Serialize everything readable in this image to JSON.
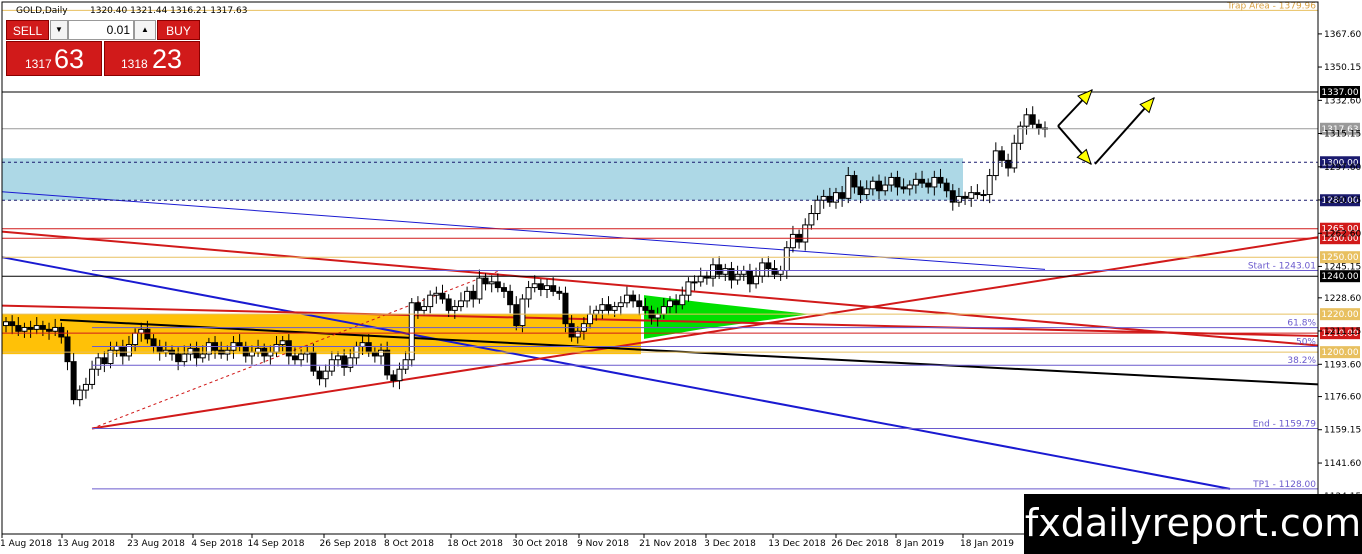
{
  "header": {
    "title": "GOLD,Daily",
    "ohlc": "1320.40 1321.44 1316.21 1317.63"
  },
  "trade_panel": {
    "sell_label": "SELL",
    "buy_label": "BUY",
    "lot_value": "0.01",
    "sell_price_small": "1317",
    "sell_price_big": "63",
    "buy_price_small": "1318",
    "buy_price_big": "23"
  },
  "watermark": "fxdailyreport.com",
  "colors": {
    "zone_blue": "#add8e6",
    "zone_orange": "#ffc107",
    "triangle_green": "#00e000",
    "trend_red": "#d11a1a",
    "trend_blue": "#1a1ad1",
    "fib_blue": "#6a5acd",
    "arrow_yellow": "#ffff00",
    "level_gold": "#e8c060"
  },
  "chart_data": {
    "type": "candlestick",
    "title": "GOLD,Daily",
    "ylim": [
      1125,
      1385
    ],
    "y_ticks": [
      1367.6,
      1350.15,
      1332.6,
      1315.15,
      1297.6,
      1280.15,
      1262.6,
      1245.15,
      1228.6,
      1211.15,
      1193.6,
      1176.6,
      1159.15,
      1141.6,
      1124.15
    ],
    "y_tick_labels": [
      "1367.60",
      "1350.15",
      "1332.60",
      "1315.15",
      "1297.60",
      "1280.15",
      "1262.60",
      "1245.15",
      "1228.60",
      "1211.15",
      "1193.60",
      "1176.60",
      "1159.15",
      "1141.60",
      "1124.15"
    ],
    "x_labels": [
      "1 Aug 2018",
      "13 Aug 2018",
      "23 Aug 2018",
      "4 Sep 2018",
      "14 Sep 2018",
      "26 Sep 2018",
      "8 Oct 2018",
      "18 Oct 2018",
      "30 Oct 2018",
      "9 Nov 2018",
      "21 Nov 2018",
      "3 Dec 2018",
      "13 Dec 2018",
      "26 Dec 2018",
      "8 Jan 2019",
      "18 Jan 2019"
    ],
    "grid": false,
    "closes": [
      1216,
      1214,
      1211,
      1213,
      1212,
      1214,
      1212,
      1211,
      1213,
      1208,
      1195,
      1175,
      1180,
      1183,
      1191,
      1197,
      1194,
      1201,
      1203,
      1198,
      1204,
      1210,
      1212,
      1207,
      1203,
      1200,
      1201,
      1199,
      1195,
      1199,
      1202,
      1197,
      1199,
      1205,
      1201,
      1199,
      1201,
      1205,
      1203,
      1198,
      1200,
      1202,
      1198,
      1200,
      1204,
      1206,
      1198,
      1196,
      1199,
      1200,
      1190,
      1186,
      1190,
      1196,
      1198,
      1192,
      1197,
      1203,
      1205,
      1200,
      1198,
      1201,
      1188,
      1185,
      1191,
      1196,
      1226,
      1222,
      1224,
      1230,
      1231,
      1228,
      1222,
      1224,
      1227,
      1232,
      1228,
      1239,
      1236,
      1237,
      1234,
      1232,
      1225,
      1214,
      1228,
      1234,
      1236,
      1233,
      1235,
      1232,
      1231,
      1215,
      1208,
      1211,
      1215,
      1220,
      1222,
      1225,
      1222,
      1224,
      1226,
      1230,
      1227,
      1224,
      1222,
      1218,
      1220,
      1224,
      1227,
      1225,
      1230,
      1237,
      1237,
      1240,
      1239,
      1246,
      1241,
      1244,
      1238,
      1241,
      1243,
      1236,
      1240,
      1247,
      1244,
      1241,
      1243,
      1255,
      1262,
      1258,
      1267,
      1273,
      1280,
      1282,
      1279,
      1284,
      1281,
      1293,
      1287,
      1283,
      1286,
      1290,
      1285,
      1288,
      1292,
      1287,
      1286,
      1288,
      1291,
      1289,
      1287,
      1292,
      1289,
      1285,
      1279,
      1282,
      1281,
      1284,
      1283,
      1283,
      1293,
      1306,
      1301,
      1297,
      1310,
      1319,
      1325,
      1320,
      1318,
      1317.63
    ],
    "levels": [
      {
        "value": 1379.96,
        "label": "Trap Area - 1379.96",
        "color": "#e8c060"
      },
      {
        "value": 1337.0,
        "label": "1337.00",
        "color": "#000000"
      },
      {
        "value": 1317.63,
        "label": "1317.63",
        "color": "#999999"
      },
      {
        "value": 1300.0,
        "label": "1300.00",
        "color": "#1a1a6e"
      },
      {
        "value": 1280.0,
        "label": "1280.00",
        "color": "#1a1a6e"
      },
      {
        "value": 1265.0,
        "label": "1265.00",
        "color": "#d11a1a"
      },
      {
        "value": 1260.0,
        "label": "1260.00",
        "color": "#d11a1a"
      },
      {
        "value": 1250.0,
        "label": "1250.00",
        "color": "#e8c060"
      },
      {
        "value": 1240.0,
        "label": "1240.00",
        "color": "#000000"
      },
      {
        "value": 1220.0,
        "label": "1220.00",
        "color": "#e8c060"
      },
      {
        "value": 1210.0,
        "label": "1210.00",
        "color": "#d11a1a"
      },
      {
        "value": 1200.0,
        "label": "1200.00",
        "color": "#e8c060"
      }
    ],
    "fib_annotations": [
      {
        "value": 1243.01,
        "label": "Start - 1243.01"
      },
      {
        "value": 1212.9,
        "label": "61.8%"
      },
      {
        "value": 1203.0,
        "label": "50%"
      },
      {
        "value": 1193.1,
        "label": "38.2%"
      },
      {
        "value": 1159.79,
        "label": "End - 1159.79"
      },
      {
        "value": 1128.0,
        "label": "TP1 - 1128.00"
      }
    ]
  }
}
